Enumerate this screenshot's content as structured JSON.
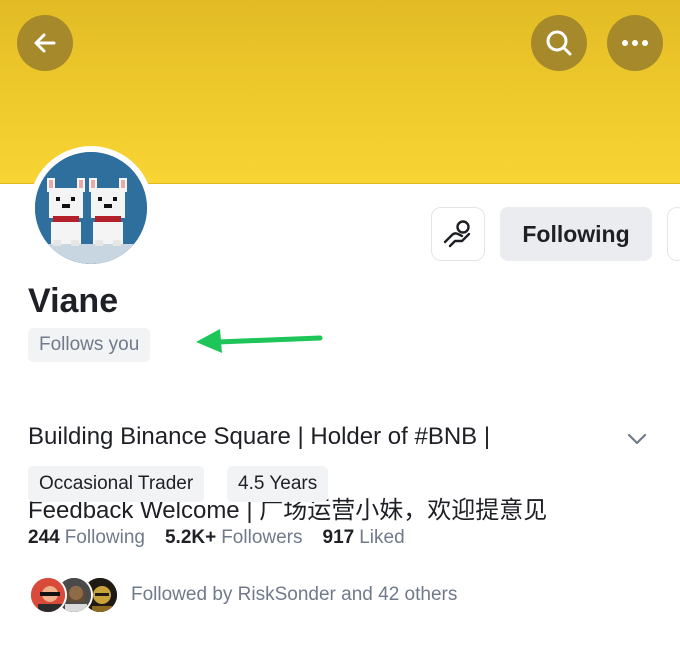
{
  "profile": {
    "name": "Viane",
    "follows_you": "Follows you",
    "bio_line_1": "Building Binance Square | Holder of #BNB |",
    "bio_line_2": "Feedback Welcome | 广场运营小妹，欢迎提意见",
    "tags": [
      "Occasional Trader",
      "4.5 Years"
    ]
  },
  "actions": {
    "following_label": "Following"
  },
  "stats": {
    "following_count": "244",
    "following_label": "Following",
    "followers_count": "5.2K+",
    "followers_label": "Followers",
    "liked_count": "917",
    "liked_label": "Liked"
  },
  "followed_by": {
    "text": "Followed by RiskSonder and 42 others"
  },
  "icons": {
    "back": "back-arrow-icon",
    "search": "search-icon",
    "more": "more-dots-icon",
    "gift": "tip-hand-icon",
    "expand": "chevron-down-icon",
    "annotation": "green-arrow-annotation"
  },
  "colors": {
    "banner": "#f0c82e",
    "header_button": "#a6892a",
    "annotation_arrow": "#1ec65a",
    "muted_text": "#707a8a",
    "chip_bg": "#f2f3f5"
  }
}
